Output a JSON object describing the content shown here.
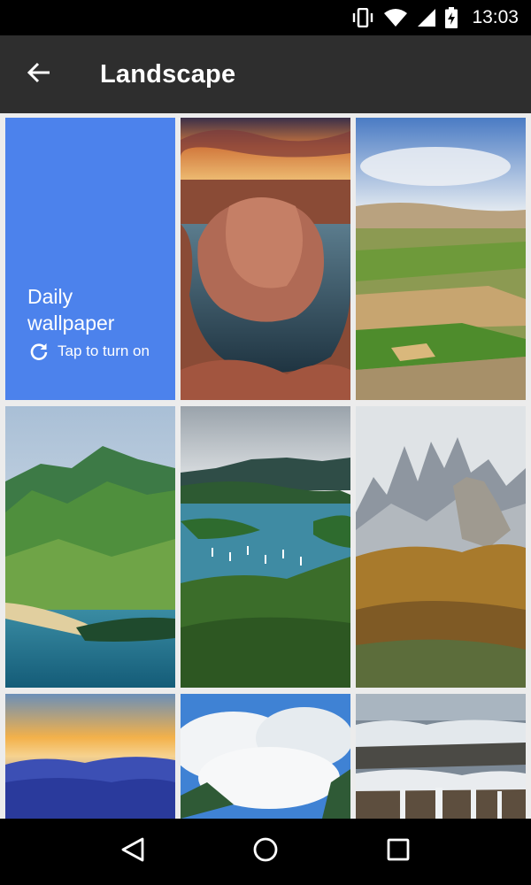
{
  "status_bar": {
    "time": "13:03",
    "icons": [
      "vibrate-icon",
      "wifi-icon",
      "cell-signal-icon",
      "battery-charging-icon"
    ]
  },
  "app_bar": {
    "title": "Landscape",
    "back_icon": "arrow-back-icon"
  },
  "daily_tile": {
    "title_line1": "Daily",
    "title_line2": "wallpaper",
    "action_label": "Tap to turn on",
    "action_icon": "refresh-icon",
    "color": "#4c82ec"
  },
  "wallpapers": [
    {
      "name": "canyon-bend",
      "index": 1
    },
    {
      "name": "green-valley-fields",
      "index": 2
    },
    {
      "name": "coastal-mountains",
      "index": 3
    },
    {
      "name": "harbor-bay",
      "index": 4
    },
    {
      "name": "rocky-peaks",
      "index": 5
    },
    {
      "name": "sunset-fog",
      "index": 6
    },
    {
      "name": "clouds-sky",
      "index": 7
    },
    {
      "name": "waterfall-snow",
      "index": 8
    }
  ],
  "nav_bar": {
    "items": [
      "back-triangle-icon",
      "home-circle-icon",
      "recents-square-icon"
    ]
  }
}
